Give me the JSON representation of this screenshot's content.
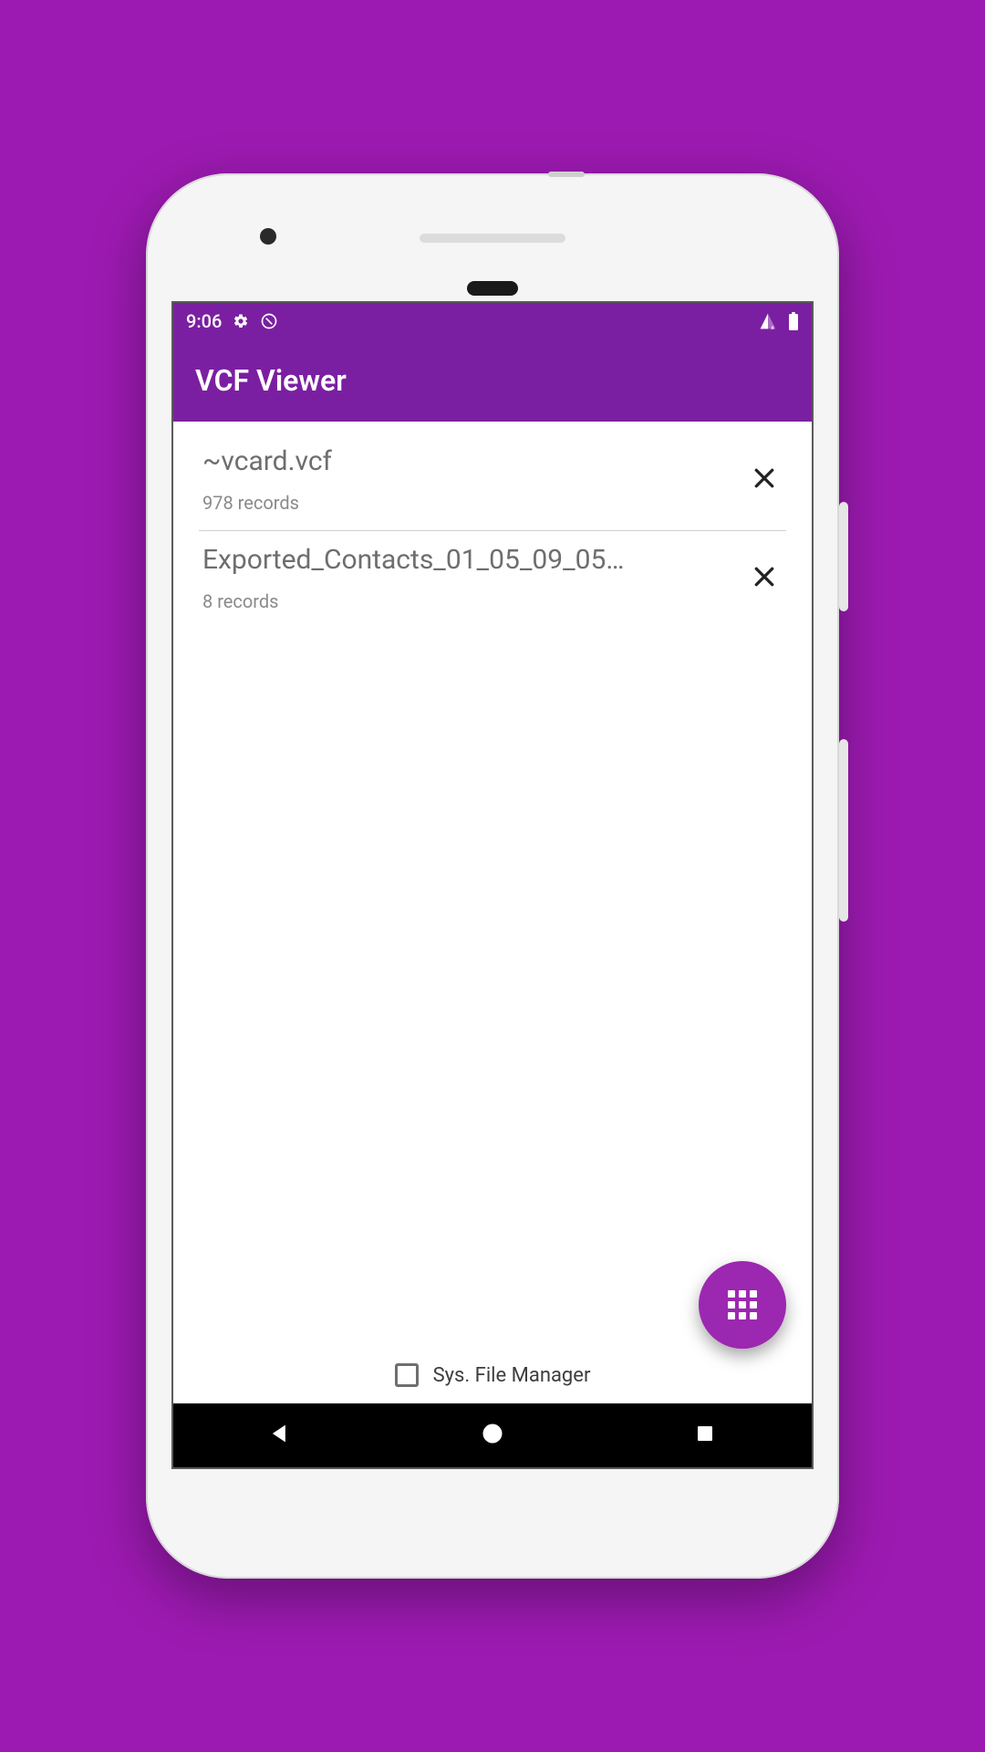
{
  "statusbar": {
    "time": "9:06"
  },
  "appbar": {
    "title": "VCF Viewer"
  },
  "files": [
    {
      "name": "~vcard.vcf",
      "sub": "978 records"
    },
    {
      "name": "Exported_Contacts_01_05_09_05…",
      "sub": "8 records"
    }
  ],
  "bottom": {
    "checkbox_label": "Sys. File Manager",
    "checked": false
  },
  "colors": {
    "primary": "#7b1fa2",
    "accent": "#9c27b0",
    "background": "#9c1ab1"
  }
}
